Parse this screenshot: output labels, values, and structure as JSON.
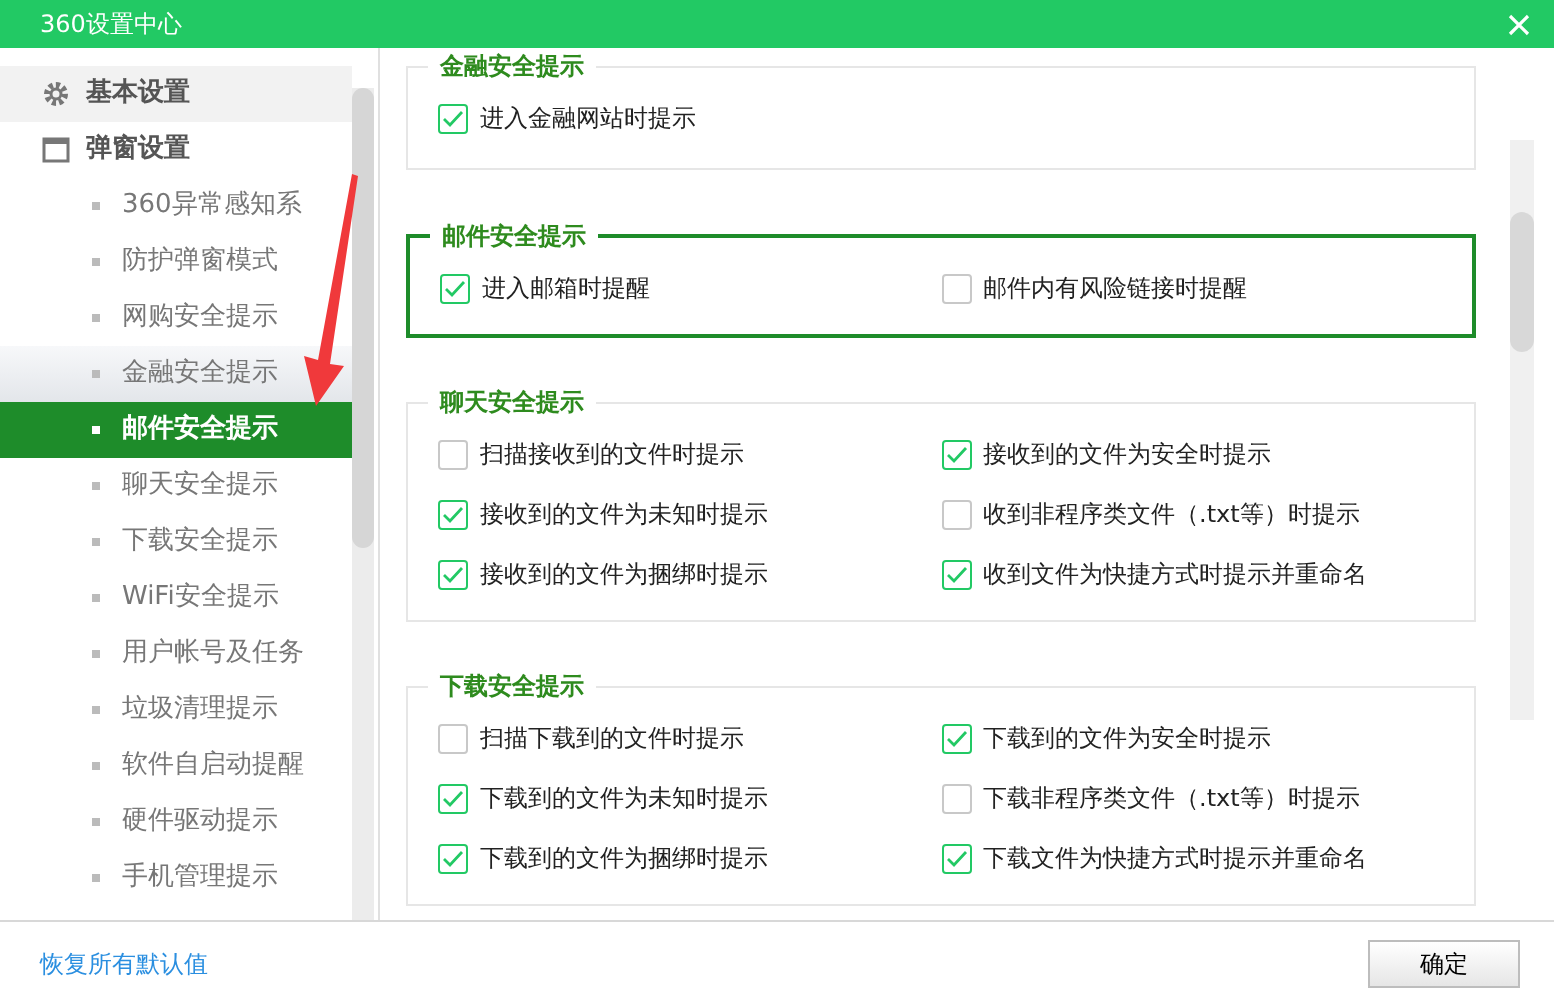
{
  "window": {
    "title": "360设置中心"
  },
  "sidebar": {
    "items": [
      {
        "kind": "group",
        "label": "基本设置",
        "selected": false,
        "hovered": true
      },
      {
        "kind": "group",
        "label": "弹窗设置",
        "selected": false,
        "hovered": false
      },
      {
        "kind": "sub",
        "label": "360异常感知系",
        "selected": false,
        "hovered": false
      },
      {
        "kind": "sub",
        "label": "防护弹窗模式",
        "selected": false,
        "hovered": false
      },
      {
        "kind": "sub",
        "label": "网购安全提示",
        "selected": false,
        "hovered": false
      },
      {
        "kind": "sub",
        "label": "金融安全提示",
        "selected": false,
        "hovered": true
      },
      {
        "kind": "sub",
        "label": "邮件安全提示",
        "selected": true,
        "hovered": false
      },
      {
        "kind": "sub",
        "label": "聊天安全提示",
        "selected": false,
        "hovered": false
      },
      {
        "kind": "sub",
        "label": "下载安全提示",
        "selected": false,
        "hovered": false
      },
      {
        "kind": "sub",
        "label": "WiFi安全提示",
        "selected": false,
        "hovered": false
      },
      {
        "kind": "sub",
        "label": "用户帐号及任务",
        "selected": false,
        "hovered": false
      },
      {
        "kind": "sub",
        "label": "垃圾清理提示",
        "selected": false,
        "hovered": false
      },
      {
        "kind": "sub",
        "label": "软件自启动提醒",
        "selected": false,
        "hovered": false
      },
      {
        "kind": "sub",
        "label": "硬件驱动提示",
        "selected": false,
        "hovered": false
      },
      {
        "kind": "sub",
        "label": "手机管理提示",
        "selected": false,
        "hovered": false
      }
    ]
  },
  "sections": [
    {
      "title": "金融安全提示",
      "selected": false,
      "options": [
        {
          "label": "进入金融网站时提示",
          "checked": true
        }
      ]
    },
    {
      "title": "邮件安全提示",
      "selected": true,
      "options": [
        {
          "label": "进入邮箱时提醒",
          "checked": true
        },
        {
          "label": "邮件内有风险链接时提醒",
          "checked": false
        }
      ]
    },
    {
      "title": "聊天安全提示",
      "selected": false,
      "options": [
        {
          "label": "扫描接收到的文件时提示",
          "checked": false
        },
        {
          "label": "接收到的文件为安全时提示",
          "checked": true
        },
        {
          "label": "接收到的文件为未知时提示",
          "checked": true
        },
        {
          "label": "收到非程序类文件（.txt等）时提示",
          "checked": false
        },
        {
          "label": "接收到的文件为捆绑时提示",
          "checked": true
        },
        {
          "label": "收到文件为快捷方式时提示并重命名",
          "checked": true
        }
      ]
    },
    {
      "title": "下载安全提示",
      "selected": false,
      "options": [
        {
          "label": "扫描下载到的文件时提示",
          "checked": false
        },
        {
          "label": "下载到的文件为安全时提示",
          "checked": true
        },
        {
          "label": "下载到的文件为未知时提示",
          "checked": true
        },
        {
          "label": "下载非程序类文件（.txt等）时提示",
          "checked": false
        },
        {
          "label": "下载到的文件为捆绑时提示",
          "checked": true
        },
        {
          "label": "下载文件为快捷方式时提示并重命名",
          "checked": true
        }
      ]
    }
  ],
  "footer": {
    "restore_link": "恢复所有默认值",
    "ok_button": "确定"
  }
}
